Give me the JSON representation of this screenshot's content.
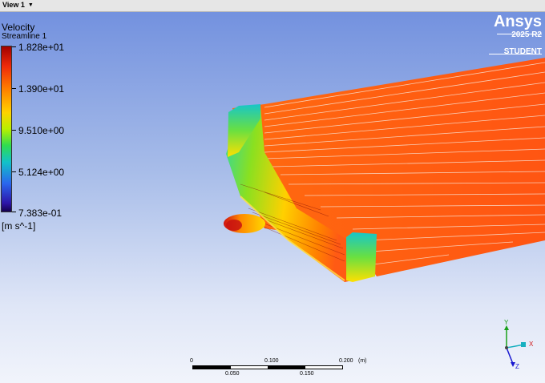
{
  "view": {
    "tab_label": "View 1",
    "dropdown_icon": "chevron-down-icon"
  },
  "logo": {
    "word": "Ansys",
    "version": "2025 R2",
    "edition": "STUDENT"
  },
  "legend": {
    "variable": "Velocity",
    "object": "Streamline 1",
    "ticks": [
      "1.828e+01",
      "1.390e+01",
      "9.510e+00",
      "5.124e+00",
      "7.383e-01"
    ],
    "unit": "[m s^-1]"
  },
  "scale": {
    "top_labels": [
      "0",
      "0.100",
      "0.200",
      "(m)"
    ],
    "bottom_labels": [
      "0.050",
      "0.150"
    ]
  },
  "axes": {
    "x": "X",
    "y": "Y",
    "z": "Z"
  },
  "colors": {
    "background_top": "#6f8ede",
    "background_bottom": "#f1f4fb",
    "streamline": "#ff5a14",
    "wing": "#2fdc50"
  }
}
